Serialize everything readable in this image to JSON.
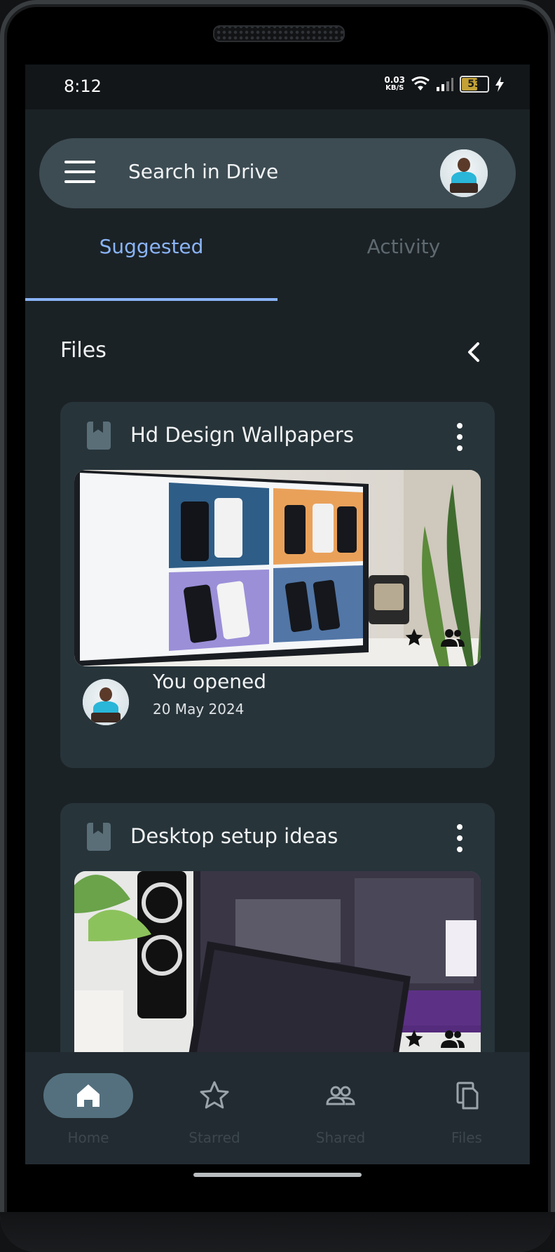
{
  "status_bar": {
    "time": "8:12",
    "net_speed_value": "0.03",
    "net_speed_unit": "KB/S",
    "battery": "53"
  },
  "search": {
    "placeholder": "Search in Drive"
  },
  "tabs": [
    {
      "label": "Suggested",
      "active": true
    },
    {
      "label": "Activity",
      "active": false
    }
  ],
  "section": {
    "title": "Files"
  },
  "files": [
    {
      "title": "Hd Design Wallpapers",
      "opened_label": "You opened",
      "opened_date": "20 May 2024"
    },
    {
      "title": "Desktop setup ideas"
    }
  ],
  "bottom_nav": [
    {
      "label": "Home",
      "icon": "home-icon",
      "active": true
    },
    {
      "label": "Starred",
      "icon": "star-icon",
      "active": false
    },
    {
      "label": "Shared",
      "icon": "people-icon",
      "active": false
    },
    {
      "label": "Files",
      "icon": "files-icon",
      "active": false
    }
  ],
  "colors": {
    "accent": "#8ab4f8",
    "surface": "#1b2226",
    "card": "#27343a",
    "searchbar": "#3d4c53",
    "nav_pill": "#54707e"
  }
}
